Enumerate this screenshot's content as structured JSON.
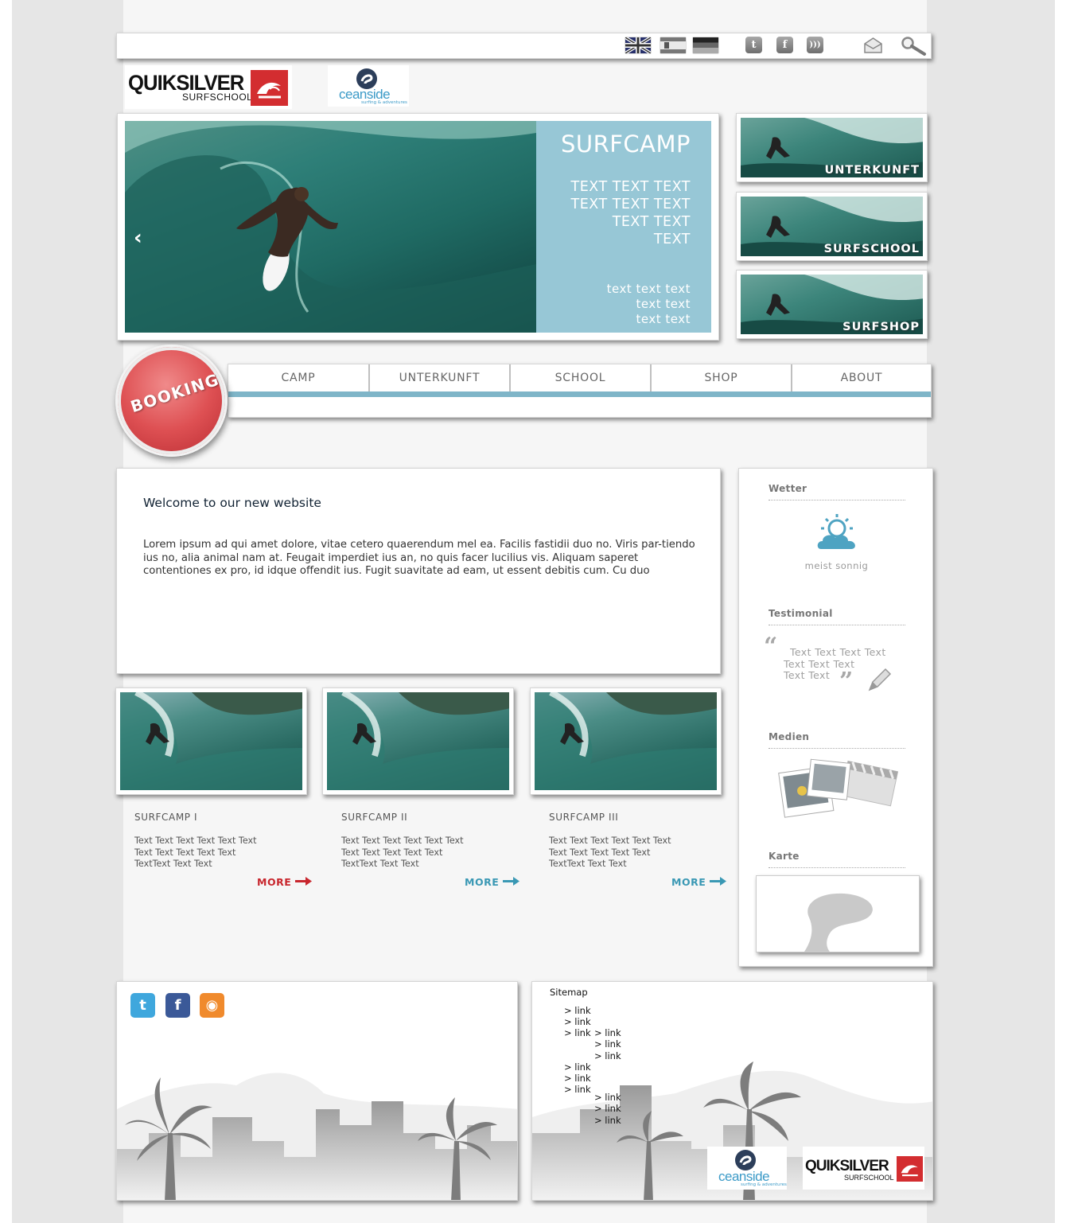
{
  "header": {
    "flags": [
      "uk-flag-icon",
      "spain-flag-icon",
      "germany-flag-icon"
    ],
    "social_icons": [
      "twitter-icon",
      "facebook-icon",
      "rss-icon"
    ],
    "tools": [
      "mail-icon",
      "search-icon"
    ]
  },
  "logos": {
    "quiksilver": {
      "name": "QUIKSILVER",
      "sub": "SURFSCHOOL"
    },
    "oceanside": {
      "name": "ceanside",
      "sub": "surfing & adventures"
    }
  },
  "hero": {
    "title": "SURFCAMP",
    "big_text": [
      "TEXT TEXT TEXT",
      "TEXT TEXT TEXT",
      "TEXT TEXT",
      "TEXT"
    ],
    "small_text": [
      "text text text",
      "text text",
      "text text"
    ],
    "prev_arrow": "‹"
  },
  "thumbs": [
    {
      "label": "UNTERKUNFT"
    },
    {
      "label": "SURFSCHOOL"
    },
    {
      "label": "SURFSHOP"
    }
  ],
  "booking": {
    "label": "BOOKING"
  },
  "nav": {
    "items": [
      {
        "label": "CAMP"
      },
      {
        "label": "UNTERKUNFT"
      },
      {
        "label": "SCHOOL"
      },
      {
        "label": "SHOP"
      },
      {
        "label": "ABOUT"
      }
    ]
  },
  "welcome": {
    "heading": "Welcome to our new website",
    "body": "Lorem ipsum ad qui amet dolore, vitae cetero quaerendum mel ea. Facilis fastidii duo no. Viris par-tiendo ius no, alia animal nam at. Feugait imperdiet ius an, no quis facer lucilius vis. Aliquam saperet contentiones ex pro, id idque offendit ius. Fugit suavitate ad eam, ut essent debitis cum. Cu duo"
  },
  "cards": [
    {
      "title": "SURFCAMP I",
      "lines": [
        "Text Text Text Text Text Text",
        "Text Text Text Text Text",
        "TextText Text Text"
      ],
      "more": "MORE",
      "color": "#c8262d"
    },
    {
      "title": "SURFCAMP II",
      "lines": [
        "Text Text Text Text Text Text",
        "Text Text Text Text Text",
        "TextText Text Text"
      ],
      "more": "MORE",
      "color": "#3a98b4"
    },
    {
      "title": "SURFCAMP III",
      "lines": [
        "Text Text Text Text Text Text",
        "Text Text Text Text Text",
        "TextText Text Text"
      ],
      "more": "MORE",
      "color": "#3a98b4"
    }
  ],
  "sidebar": {
    "weather": {
      "heading": "Wetter",
      "text": "meist sonnig"
    },
    "testimonial": {
      "heading": "Testimonial",
      "lines": [
        "Text Text Text Text",
        "Text Text Text",
        "Text Text"
      ]
    },
    "media": {
      "heading": "Medien"
    },
    "map": {
      "heading": "Karte"
    }
  },
  "footer": {
    "sitemap": {
      "title": "Sitemap",
      "links": [
        {
          "text": "> link",
          "level": 0
        },
        {
          "text": "> link",
          "level": 0
        },
        {
          "text": "> link",
          "level": 0
        },
        {
          "text": "> link",
          "level": 1
        },
        {
          "text": "> link",
          "level": 1
        },
        {
          "text": "> link",
          "level": 1
        },
        {
          "text": "> link",
          "level": 0
        },
        {
          "text": "> link",
          "level": 0
        },
        {
          "text": "> link",
          "level": 0
        },
        {
          "text": "> link",
          "level": 1
        },
        {
          "text": "> link",
          "level": 1
        },
        {
          "text": "> link",
          "level": 1
        }
      ]
    },
    "social": [
      {
        "icon": "twitter-icon",
        "glyph": "t",
        "color": "#3fa7dd"
      },
      {
        "icon": "facebook-icon",
        "glyph": "f",
        "color": "#3b5998"
      },
      {
        "icon": "rss-icon",
        "glyph": "◉",
        "color": "#f08a2c"
      }
    ]
  }
}
